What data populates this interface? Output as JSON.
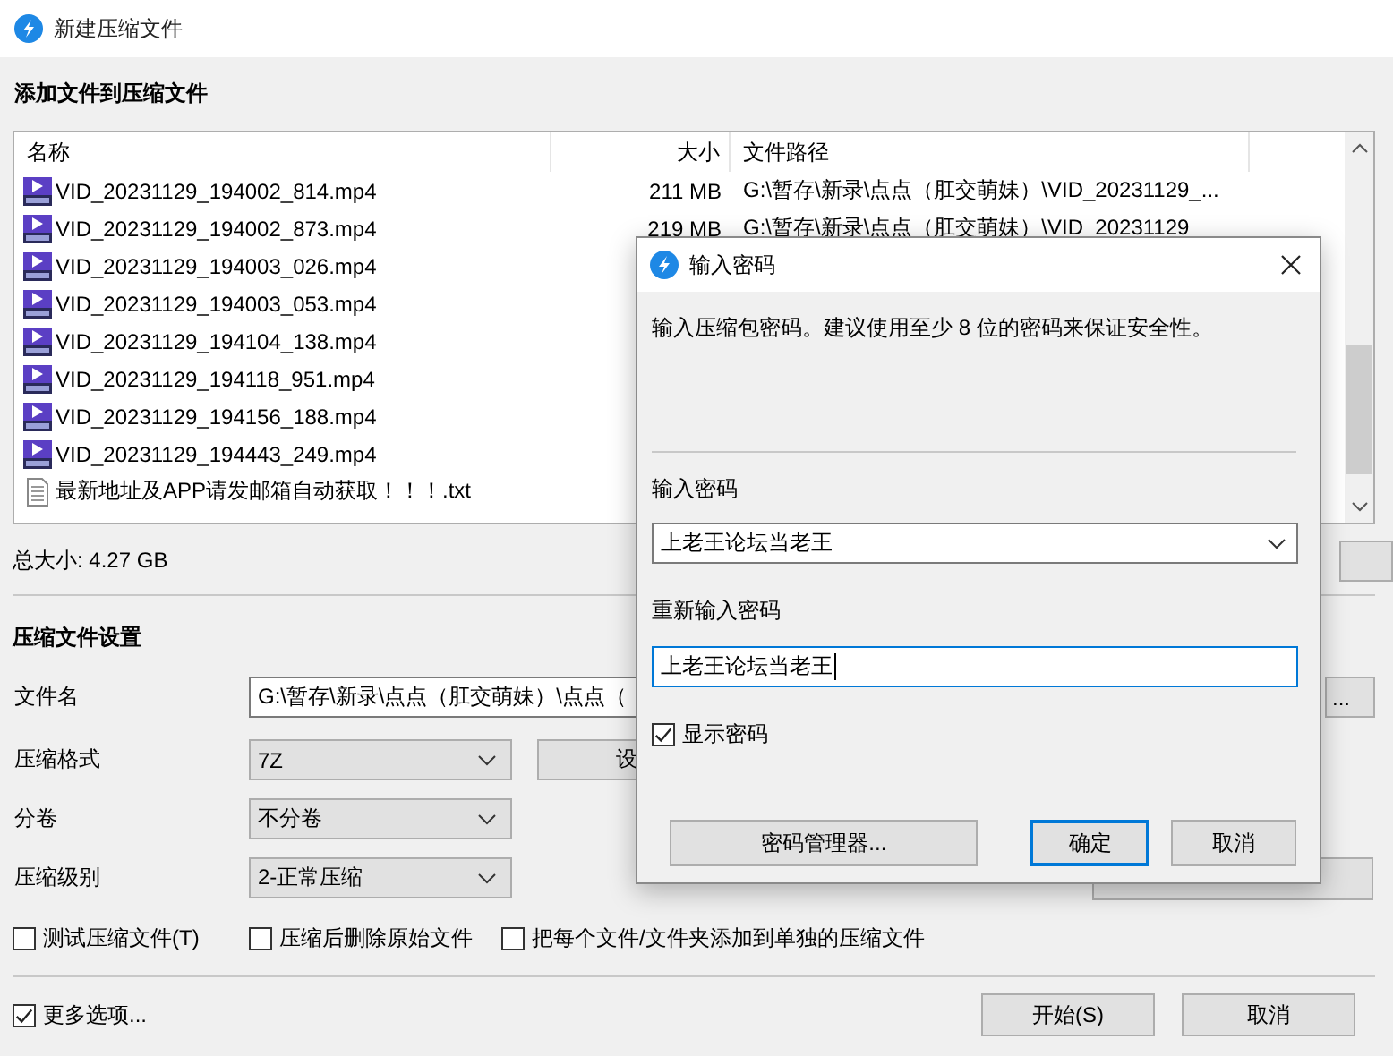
{
  "window": {
    "title": "新建压缩文件"
  },
  "files": {
    "heading": "添加文件到压缩文件",
    "columns": [
      "名称",
      "大小",
      "文件路径"
    ],
    "rows": [
      {
        "name": "VID_20231129_194002_814.mp4",
        "kind": "video",
        "size": "211 MB",
        "path": "G:\\暂存\\新录\\点点（肛交萌妹）\\VID_20231129_..."
      },
      {
        "name": "VID_20231129_194002_873.mp4",
        "kind": "video",
        "size": "219 MB",
        "path": "G:\\暂存\\新录\\点点（肛交萌妹）\\VID_20231129"
      },
      {
        "name": "VID_20231129_194003_026.mp4",
        "kind": "video"
      },
      {
        "name": "VID_20231129_194003_053.mp4",
        "kind": "video"
      },
      {
        "name": "VID_20231129_194104_138.mp4",
        "kind": "video"
      },
      {
        "name": "VID_20231129_194118_951.mp4",
        "kind": "video"
      },
      {
        "name": "VID_20231129_194156_188.mp4",
        "kind": "video"
      },
      {
        "name": "VID_20231129_194443_249.mp4",
        "kind": "video"
      },
      {
        "name": "最新地址及APP请发邮箱自动获取！！！.txt",
        "kind": "text"
      }
    ],
    "total": "总大小: 4.27 GB"
  },
  "settings": {
    "heading": "压缩文件设置",
    "filename": {
      "label": "文件名",
      "value": "G:\\暂存\\新录\\点点（肛交萌妹）\\点点（"
    },
    "browse_button": "...",
    "format": {
      "label": "压缩格式",
      "value": "7Z"
    },
    "format_button": "设",
    "split": {
      "label": "分卷",
      "value": "不分卷"
    },
    "level": {
      "label": "压缩级别",
      "value": "2-正常压缩"
    },
    "options": [
      {
        "label": "测试压缩文件(T)",
        "checked": false
      },
      {
        "label": "压缩后删除原始文件",
        "checked": false
      },
      {
        "label": "把每个文件/文件夹添加到单独的压缩文件",
        "checked": false
      }
    ],
    "more_options": {
      "label": "更多选项...",
      "checked": true
    }
  },
  "buttons": [
    {
      "label": "开始(S)"
    },
    {
      "label": "取消"
    }
  ],
  "dialog": {
    "title": "输入密码",
    "message": "输入压缩包密码。建议使用至少 8 位的密码来保证安全性。",
    "password_label": "输入密码",
    "password": "上老王论坛当老王",
    "confirm_label": "重新输入密码",
    "confirm": "上老王论坛当老王",
    "show_password": {
      "label": "显示密码",
      "checked": true
    },
    "buttons": [
      {
        "label": "密码管理器...",
        "default": false
      },
      {
        "label": "确定",
        "default": true
      },
      {
        "label": "取消",
        "default": false
      }
    ]
  }
}
